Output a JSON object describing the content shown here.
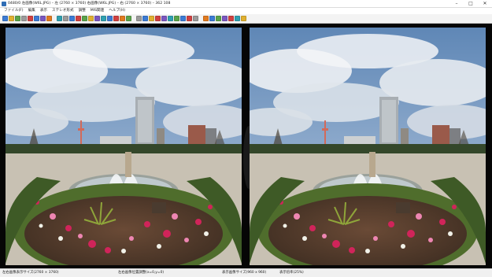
{
  "window": {
    "title": "0480/0 左画像(W6L.JPG) – 左 (2760 × 3760) 右画像(W6L.JPG) – 右 (2760 × 3760) – 362 108"
  },
  "menu": [
    "ファイル(F)",
    "編集",
    "表示",
    "ステレオ形式",
    "調整",
    "MIS関連",
    "ヘルプ(H)"
  ],
  "toolbar": {
    "icon_colors": [
      "#3b7bd4",
      "#e0b030",
      "#5aa34a",
      "#9b9b9b",
      "#d04040",
      "#3b7bd4",
      "#7a56c0",
      "#e07a20",
      "#2fa0b0",
      "#9b9b9b",
      "#3b7bd4",
      "#d04040",
      "#5aa34a",
      "#e0b030",
      "#7a56c0",
      "#2fa0b0",
      "#3b7bd4",
      "#d04040",
      "#e07a20",
      "#5aa34a",
      "#9b9b9b",
      "#3b7bd4",
      "#e0b030",
      "#d04040",
      "#7a56c0",
      "#2fa0b0",
      "#5aa34a",
      "#3b7bd4",
      "#d04040",
      "#9b9b9b",
      "#e07a20",
      "#3b7bd4",
      "#5aa34a",
      "#7a56c0",
      "#d04040",
      "#2fa0b0",
      "#e0b030"
    ]
  },
  "status": {
    "left": "左右画像表示サイズ(2760 × 3760)",
    "center": "左右画像位置調整(x=0,y=0)",
    "right": "表示画像サイズ(960 x 960)",
    "zoom": "表示倍率(25%)"
  },
  "colors": {
    "sky": "#7fa3c9",
    "cloud": "#eef1f4",
    "grass": "#4f6d2c",
    "path": "#c8c1b3",
    "water": "#bfc9cd",
    "flower_red": "#d0245a",
    "flower_pink": "#ee86b2",
    "flower_white": "#f1f1e8"
  }
}
